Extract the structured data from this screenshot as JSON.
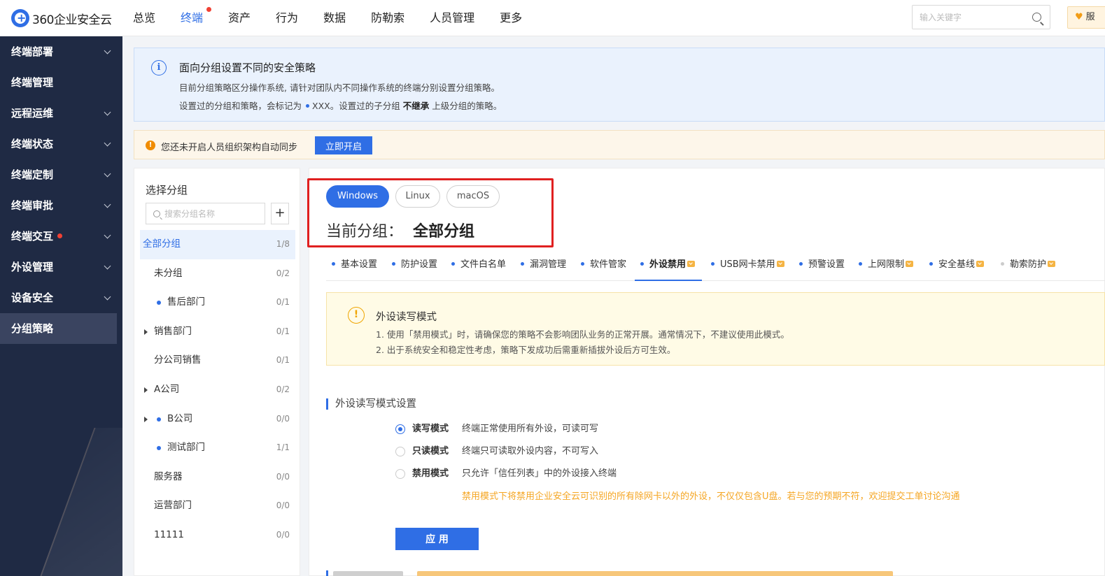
{
  "header": {
    "logo_text": "360企业安全云",
    "nav": [
      {
        "label": "总览",
        "active": false,
        "dot": false
      },
      {
        "label": "终端",
        "active": true,
        "dot": true
      },
      {
        "label": "资产",
        "active": false,
        "dot": false
      },
      {
        "label": "行为",
        "active": false,
        "dot": false
      },
      {
        "label": "数据",
        "active": false,
        "dot": false
      },
      {
        "label": "防勒索",
        "active": false,
        "dot": false
      },
      {
        "label": "人员管理",
        "active": false,
        "dot": false
      },
      {
        "label": "更多",
        "active": false,
        "dot": false
      }
    ],
    "search_placeholder": "输入关键字",
    "service_label": "服"
  },
  "sidebar": {
    "items": [
      {
        "label": "终端部署",
        "expandable": true,
        "active": false,
        "dot": false
      },
      {
        "label": "终端管理",
        "expandable": false,
        "active": false,
        "dot": false
      },
      {
        "label": "远程运维",
        "expandable": true,
        "active": false,
        "dot": false
      },
      {
        "label": "终端状态",
        "expandable": true,
        "active": false,
        "dot": false
      },
      {
        "label": "终端定制",
        "expandable": true,
        "active": false,
        "dot": false
      },
      {
        "label": "终端审批",
        "expandable": true,
        "active": false,
        "dot": false
      },
      {
        "label": "终端交互",
        "expandable": true,
        "active": false,
        "dot": true
      },
      {
        "label": "外设管理",
        "expandable": true,
        "active": false,
        "dot": false
      },
      {
        "label": "设备安全",
        "expandable": true,
        "active": false,
        "dot": false
      },
      {
        "label": "分组策略",
        "expandable": false,
        "active": true,
        "dot": false
      }
    ]
  },
  "info_banner": {
    "title": "面向分组设置不同的安全策略",
    "line1": "目前分组策略区分操作系统, 请针对团队内不同操作系统的终端分别设置分组策略。",
    "line2_a": "设置过的分组和策略，会标记为",
    "line2_b": "XXX",
    "line2_c": "。设置过的子分组",
    "line2_bold": "不继承",
    "line2_d": "上级分组的策略。"
  },
  "warn_banner": {
    "icon": "!",
    "text": "您还未开启人员组织架构自动同步",
    "button": "立即开启"
  },
  "group_panel": {
    "title": "选择分组",
    "search_placeholder": "搜索分组名称",
    "add_label": "+",
    "tree": [
      {
        "label": "全部分组",
        "count": "1/8",
        "selected": true,
        "indent": 0,
        "arrow": false,
        "dot": false
      },
      {
        "label": "未分组",
        "count": "0/2",
        "selected": false,
        "indent": 1,
        "arrow": false,
        "dot": false
      },
      {
        "label": "售后部门",
        "count": "0/1",
        "selected": false,
        "indent": 1,
        "arrow": false,
        "dot": true
      },
      {
        "label": "销售部门",
        "count": "0/1",
        "selected": false,
        "indent": 1,
        "arrow": true,
        "dot": false
      },
      {
        "label": "分公司销售",
        "count": "0/1",
        "selected": false,
        "indent": 1,
        "arrow": false,
        "dot": false
      },
      {
        "label": "A公司",
        "count": "0/2",
        "selected": false,
        "indent": 1,
        "arrow": true,
        "dot": false
      },
      {
        "label": "B公司",
        "count": "0/0",
        "selected": false,
        "indent": 1,
        "arrow": true,
        "dot": true
      },
      {
        "label": "测试部门",
        "count": "1/1",
        "selected": false,
        "indent": 1,
        "arrow": false,
        "dot": true
      },
      {
        "label": "服务器",
        "count": "0/0",
        "selected": false,
        "indent": 1,
        "arrow": false,
        "dot": false
      },
      {
        "label": "运营部门",
        "count": "0/0",
        "selected": false,
        "indent": 1,
        "arrow": false,
        "dot": false
      },
      {
        "label": "11111",
        "count": "0/0",
        "selected": false,
        "indent": 1,
        "arrow": false,
        "dot": false
      }
    ]
  },
  "main": {
    "os_tabs": [
      {
        "label": "Windows",
        "active": true
      },
      {
        "label": "Linux",
        "active": false
      },
      {
        "label": "macOS",
        "active": false
      }
    ],
    "current_group_label": "当前分组：",
    "current_group_name": "全部分组",
    "policy_tabs": [
      {
        "label": "基本设置",
        "dot": "blue",
        "vip": false,
        "active": false
      },
      {
        "label": "防护设置",
        "dot": "blue",
        "vip": false,
        "active": false
      },
      {
        "label": "文件白名单",
        "dot": "blue",
        "vip": false,
        "active": false
      },
      {
        "label": "漏洞管理",
        "dot": "blue",
        "vip": false,
        "active": false
      },
      {
        "label": "软件管家",
        "dot": "blue",
        "vip": false,
        "active": false
      },
      {
        "label": "外设禁用",
        "dot": "blue",
        "vip": true,
        "active": true
      },
      {
        "label": "USB网卡禁用",
        "dot": "blue",
        "vip": true,
        "active": false
      },
      {
        "label": "预警设置",
        "dot": "blue",
        "vip": false,
        "active": false
      },
      {
        "label": "上网限制",
        "dot": "blue",
        "vip": true,
        "active": false
      },
      {
        "label": "安全基线",
        "dot": "blue",
        "vip": true,
        "active": false
      },
      {
        "label": "勒索防护",
        "dot": "gray",
        "vip": true,
        "active": false
      }
    ],
    "notice": {
      "icon": "!",
      "title": "外设读写模式",
      "line1": "1. 使用「禁用模式」时，请确保您的策略不会影响团队业务的正常开展。通常情况下，不建议使用此模式。",
      "line2": "2. 出于系统安全和稳定性考虑，策略下发成功后需重新插拔外设后方可生效。"
    },
    "section_title": "外设读写模式设置",
    "modes": [
      {
        "label": "读写模式",
        "desc": "终端正常使用所有外设，可读可写",
        "checked": true
      },
      {
        "label": "只读模式",
        "desc": "终端只可读取外设内容，不可写入",
        "checked": false
      },
      {
        "label": "禁用模式",
        "desc": "只允许「信任列表」中的外设接入终端",
        "checked": false
      }
    ],
    "orange_note": "禁用模式下将禁用企业安全云可识别的所有除网卡以外的外设，不仅仅包含U盘。若与您的预期不符，欢迎提交工单讨论沟通",
    "apply_label": "应 用"
  },
  "colors": {
    "primary": "#2f6ee5",
    "sidebar_bg": "#1f2a44",
    "alert_red": "#f04134",
    "warn_orange": "#f5a623",
    "highlight_box": "#e02020"
  }
}
